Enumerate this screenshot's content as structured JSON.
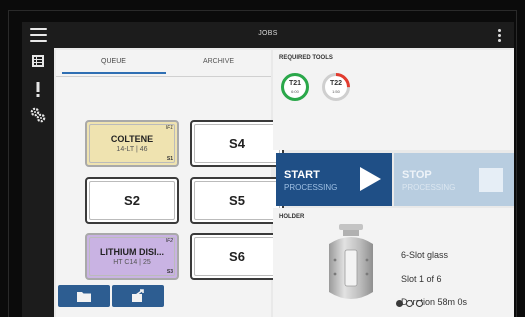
{
  "app": {
    "title": "JOBS"
  },
  "queue": {
    "tabs": [
      {
        "label": "QUEUE"
      },
      {
        "label": "ARCHIVE"
      }
    ],
    "slots": [
      {
        "name": "COLTENE",
        "sub": "14-LT | 46",
        "tag_top": "IF1",
        "tag_bottom": "S1"
      },
      {
        "label": "S4"
      },
      {
        "label": "S2"
      },
      {
        "label": "S5"
      },
      {
        "name": "LITHIUM DISI...",
        "sub": "HT C14 | 25",
        "tag_top": "IF2",
        "tag_bottom": "S3"
      },
      {
        "label": "S6"
      }
    ]
  },
  "tools": {
    "label": "REQUIRED TOOLS",
    "items": [
      {
        "name": "T21",
        "time": "6:00",
        "ring_color": "#2aa84a",
        "progress": 1.0
      },
      {
        "name": "T22",
        "time": "1:50",
        "ring_color": "#e23b2e",
        "progress": 0.25
      }
    ]
  },
  "actions": {
    "start": {
      "title": "START",
      "sub": "PROCESSING"
    },
    "stop": {
      "title": "STOP",
      "sub": "PROCESSING"
    }
  },
  "holder": {
    "label": "HOLDER",
    "type": "6-Slot glass",
    "slot": "Slot  1  of  6",
    "duration": "Duration  58m 0s",
    "page_dots": [
      true,
      false,
      false
    ]
  },
  "colors": {
    "accent": "#2f6fb3",
    "start_bg": "#1f4f86",
    "stop_bg": "#b8cde0",
    "coltene": "#efe3b0",
    "lithium": "#c9b3e3"
  }
}
